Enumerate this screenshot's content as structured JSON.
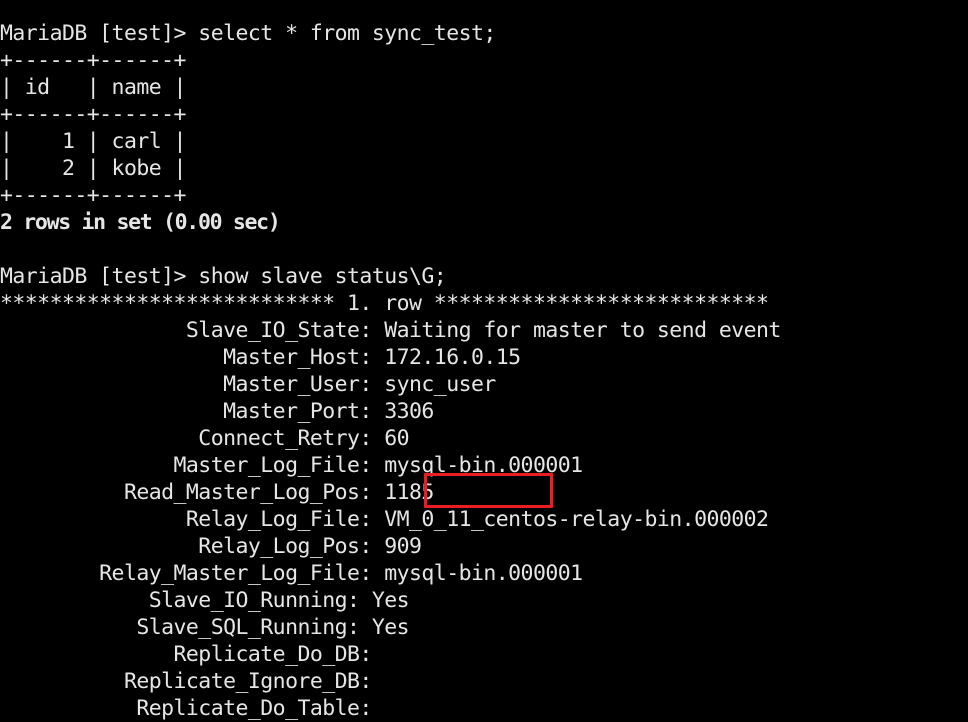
{
  "terminal": {
    "background_color": "#000000",
    "text_color": "#e6e6e6",
    "highlight_color": "#ee1c22"
  },
  "prompt_label": "MariaDB [test]> ",
  "commands": {
    "select": "select * from sync_test;",
    "show_slave": "show slave status\\G;"
  },
  "lines": {
    "l01": "MariaDB [test]> select * from sync_test;",
    "l02": "+------+------+",
    "l03": "| id   | name |",
    "l04": "+------+------+",
    "l05": "|    1 | carl |",
    "l06": "|    2 | kobe |",
    "l07": "+------+------+",
    "l08": "2 rows in set (0.00 sec)",
    "l09": "",
    "l10": "MariaDB [test]> show slave status\\G;",
    "l11": "*************************** 1. row ***************************",
    "l12": "               Slave_IO_State: Waiting for master to send event",
    "l13": "                  Master_Host: 172.16.0.15",
    "l14": "                  Master_User: sync_user",
    "l15": "                  Master_Port: 3306",
    "l16": "                Connect_Retry: 60",
    "l17": "              Master_Log_File: mysql-bin.000001",
    "l18": "          Read_Master_Log_Pos: 1185",
    "l19": "               Relay_Log_File: VM_0_11_centos-relay-bin.000002",
    "l20": "                Relay_Log_Pos: 909",
    "l21": "        Relay_Master_Log_File: mysql-bin.000001",
    "l22": "            Slave_IO_Running: Yes",
    "l23": "           Slave_SQL_Running: Yes",
    "l24": "              Replicate_Do_DB:",
    "l25": "          Replicate_Ignore_DB:",
    "l26": "           Replicate_Do_Table:"
  },
  "query_result": {
    "columns": [
      "id",
      "name"
    ],
    "rows": [
      {
        "id": "1",
        "name": "carl"
      },
      {
        "id": "2",
        "name": "kobe"
      }
    ],
    "status": "2 rows in set (0.00 sec)"
  },
  "slave_status": {
    "row_header": "*************************** 1. row ***************************",
    "fields": [
      {
        "name": "Slave_IO_State",
        "value": "Waiting for master to send event"
      },
      {
        "name": "Master_Host",
        "value": "172.16.0.15"
      },
      {
        "name": "Master_User",
        "value": "sync_user"
      },
      {
        "name": "Master_Port",
        "value": "3306"
      },
      {
        "name": "Connect_Retry",
        "value": "60"
      },
      {
        "name": "Master_Log_File",
        "value": "mysql-bin.000001"
      },
      {
        "name": "Read_Master_Log_Pos",
        "value": "1185",
        "highlighted": true
      },
      {
        "name": "Relay_Log_File",
        "value": "VM_0_11_centos-relay-bin.000002"
      },
      {
        "name": "Relay_Log_Pos",
        "value": "909"
      },
      {
        "name": "Relay_Master_Log_File",
        "value": "mysql-bin.000001"
      },
      {
        "name": "Slave_IO_Running",
        "value": "Yes"
      },
      {
        "name": "Slave_SQL_Running",
        "value": "Yes"
      },
      {
        "name": "Replicate_Do_DB",
        "value": ""
      },
      {
        "name": "Replicate_Ignore_DB",
        "value": ""
      },
      {
        "name": "Replicate_Do_Table",
        "value": ""
      }
    ]
  }
}
